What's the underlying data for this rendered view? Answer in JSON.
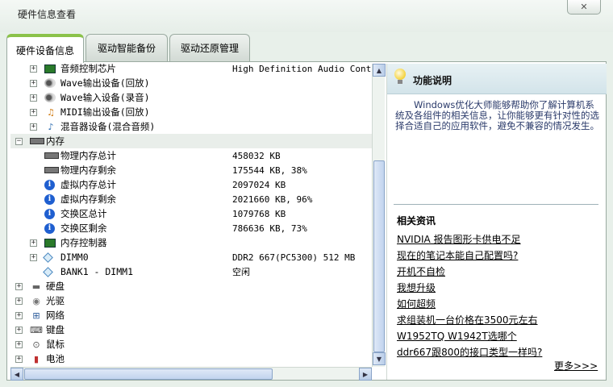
{
  "window": {
    "title": "硬件信息查看",
    "close_label": "✕"
  },
  "tabs": [
    {
      "label": "硬件设备信息",
      "active": true
    },
    {
      "label": "驱动智能备份",
      "active": false
    },
    {
      "label": "驱动还原管理",
      "active": false
    }
  ],
  "tree": {
    "rows": [
      {
        "level": 1,
        "expander": "+",
        "icon": "audio-chip-icon",
        "label": "音频控制芯片",
        "value": "High Definition Audio Controll"
      },
      {
        "level": 1,
        "expander": "+",
        "icon": "speaker-icon",
        "label": "Wave输出设备(回放)",
        "value": ""
      },
      {
        "level": 1,
        "expander": "+",
        "icon": "speaker-icon",
        "label": "Wave输入设备(录音)",
        "value": ""
      },
      {
        "level": 1,
        "expander": "+",
        "icon": "midi-icon",
        "label": "MIDI输出设备(回放)",
        "value": ""
      },
      {
        "level": 1,
        "expander": "+",
        "icon": "mixer-icon",
        "label": "混音器设备(混合音频)",
        "value": ""
      },
      {
        "level": 0,
        "expander": "−",
        "icon": "memory-icon",
        "label": "内存",
        "value": ""
      },
      {
        "level": 1,
        "expander": "",
        "icon": "memory-icon",
        "label": "物理内存总计",
        "value": "458032 KB"
      },
      {
        "level": 1,
        "expander": "",
        "icon": "memory-icon",
        "label": "物理内存剩余",
        "value": "175544 KB, 38%"
      },
      {
        "level": 1,
        "expander": "",
        "icon": "info-icon",
        "label": "虚拟内存总计",
        "value": "2097024 KB"
      },
      {
        "level": 1,
        "expander": "",
        "icon": "info-icon",
        "label": "虚拟内存剩余",
        "value": "2021660 KB, 96%"
      },
      {
        "level": 1,
        "expander": "",
        "icon": "info-icon",
        "label": "交换区总计",
        "value": "1079768 KB"
      },
      {
        "level": 1,
        "expander": "",
        "icon": "info-icon",
        "label": "交换区剩余",
        "value": "786636 KB, 73%"
      },
      {
        "level": 1,
        "expander": "+",
        "icon": "chip-icon",
        "label": "内存控制器",
        "value": ""
      },
      {
        "level": 1,
        "expander": "+",
        "icon": "diamond-icon",
        "label": "DIMM0",
        "value": "DDR2 667(PC5300) 512 MB"
      },
      {
        "level": 1,
        "expander": "",
        "icon": "diamond-icon",
        "label": "BANK1 - DIMM1",
        "value": "空闲"
      },
      {
        "level": 0,
        "expander": "+",
        "icon": "harddisk-icon",
        "label": "硬盘",
        "value": ""
      },
      {
        "level": 0,
        "expander": "+",
        "icon": "optical-drive-icon",
        "label": "光驱",
        "value": ""
      },
      {
        "level": 0,
        "expander": "+",
        "icon": "network-icon",
        "label": "网络",
        "value": ""
      },
      {
        "level": 0,
        "expander": "+",
        "icon": "keyboard-icon",
        "label": "键盘",
        "value": ""
      },
      {
        "level": 0,
        "expander": "+",
        "icon": "mouse-icon",
        "label": "鼠标",
        "value": ""
      },
      {
        "level": 0,
        "expander": "+",
        "icon": "battery-icon",
        "label": "电池",
        "value": ""
      }
    ]
  },
  "scrollbar_arrows": {
    "up": "▲",
    "down": "▼",
    "left": "◀",
    "right": "▶"
  },
  "side": {
    "title": "功能说明",
    "description": "Windows优化大师能够帮助你了解计算机系统及各组件的相关信息，让你能够更有针对性的选择合适自己的应用软件，避免不兼容的情况发生。",
    "news_title": "相关资讯",
    "news": [
      "NVIDIA 报告图形卡供电不足",
      "现在的笔记本能自己配置吗?",
      "开机不自检",
      "我想升级",
      "如何超频",
      "求组装机一台价格在3500元左右",
      "W1952TQ W1942T选哪个",
      "ddr667跟800的接口类型一样吗?"
    ],
    "more_label": "更多>>>"
  }
}
